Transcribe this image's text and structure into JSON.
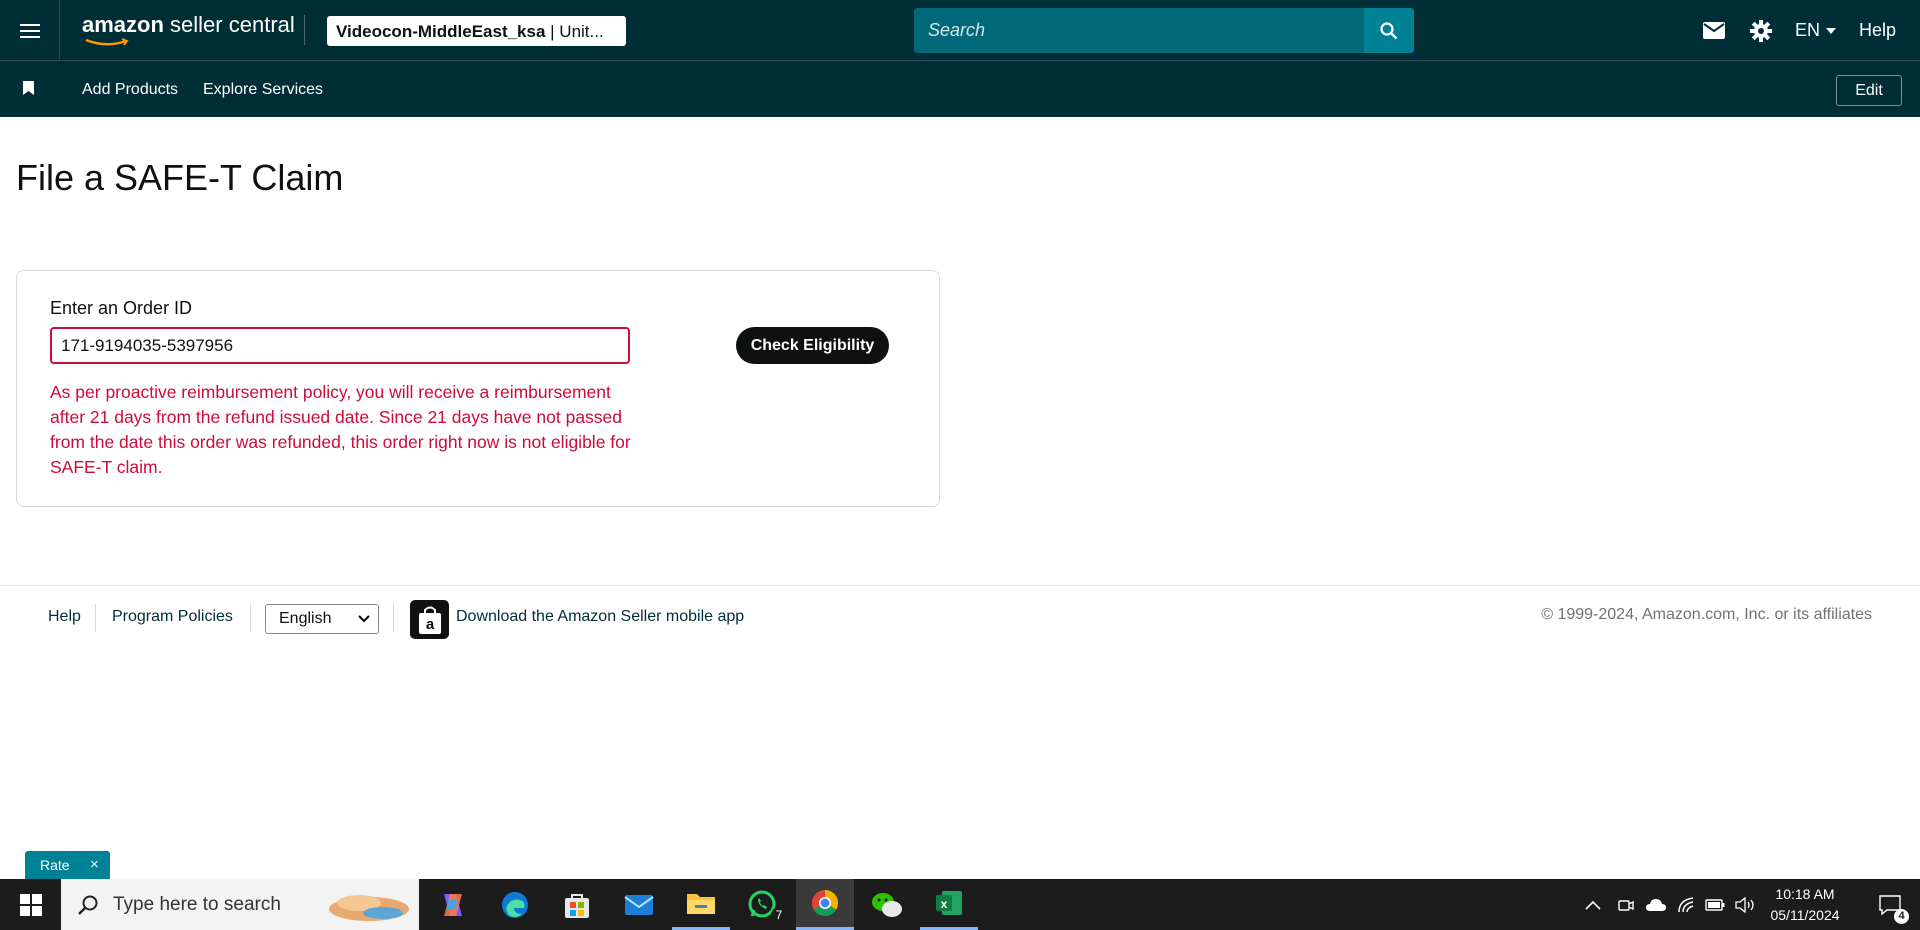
{
  "header": {
    "logo_brand": "amazon",
    "logo_product": "seller central",
    "account": {
      "name": "Videocon-MiddleEast_ksa",
      "marketplace": "| Unit..."
    },
    "search_placeholder": "Search",
    "language": "EN",
    "help": "Help"
  },
  "subnav": {
    "links": [
      "Add Products",
      "Explore Services"
    ],
    "edit": "Edit"
  },
  "page": {
    "title": "File a SAFE-T Claim"
  },
  "claim_form": {
    "label": "Enter an Order ID",
    "order_id": "171-9194035-5397956",
    "error": "As per proactive reimbursement policy, you will receive a reimbursement after 21 days from the refund issued date. Since 21 days have not passed from the date this order was refunded, this order right now is not eligible for SAFE-T claim.",
    "button": "Check Eligibility"
  },
  "footer": {
    "help": "Help",
    "program_policies": "Program Policies",
    "language_select": "English",
    "app_download": "Download the Amazon Seller mobile app",
    "copyright": "© 1999-2024, Amazon.com, Inc. or its affiliates"
  },
  "rate_widget": {
    "label": "Rate",
    "close": "×"
  },
  "taskbar": {
    "search_placeholder": "Type here to search",
    "whatsapp_badge": "7",
    "time": "10:18 AM",
    "date": "05/11/2024",
    "notification_count": "4"
  },
  "colors": {
    "header_bg": "#002e36",
    "search_bg": "#006878",
    "search_button": "#008296",
    "error": "#cc0c39",
    "button_dark": "#0f1111"
  }
}
